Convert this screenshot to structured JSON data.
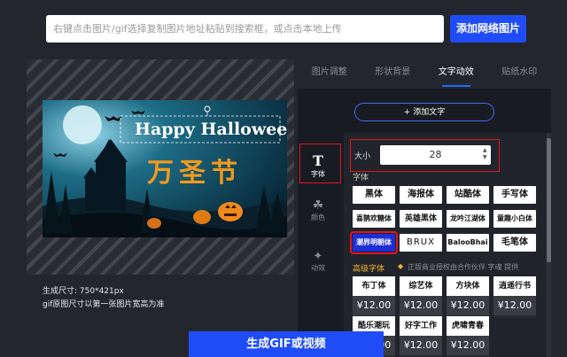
{
  "search": {
    "placeholder": "右键点击图片/gif选择复制图片地址粘贴到搜索框，或点击本地上传"
  },
  "add_image_button": "添加网络图片",
  "banner": {
    "title": "Happy Halloween",
    "subtitle": "万圣节"
  },
  "info": {
    "size_line": "生成尺寸: 750*421px",
    "note_line": "gif原图尺寸以第一张图片宽高为准"
  },
  "tabs": [
    {
      "label": "图片调整"
    },
    {
      "label": "形状背景"
    },
    {
      "label": "文字动效"
    },
    {
      "label": "贴纸水印"
    }
  ],
  "active_tab": "文字动效",
  "add_text_button": "+ 添加文字",
  "side_menu": [
    {
      "label": "字体",
      "icon": "text-T-icon"
    },
    {
      "label": "颜色",
      "icon": "paint-bucket-icon"
    },
    {
      "label": "动效",
      "icon": "sparkle-stars-icon"
    }
  ],
  "size": {
    "label": "大小",
    "value": "28"
  },
  "font_section_label": "字体",
  "fonts": [
    "黑体",
    "海报体",
    "站酷体",
    "手写体",
    "喜鹊欢糖体",
    "英雄黑体",
    "龙吟江湖体",
    "童趣小白体",
    "潮界明朝体",
    "BRUX",
    "BalooBhai",
    "毛笔体"
  ],
  "selected_font": "潮界明朝体",
  "premium": {
    "label": "高级字体",
    "note": "正版商业授权由合作伙伴 字魂 提供",
    "items": [
      {
        "name": "布丁体",
        "price": "¥12.00"
      },
      {
        "name": "综艺体",
        "price": "¥12.00"
      },
      {
        "name": "方块体",
        "price": "¥12.00"
      },
      {
        "name": "逍遥行书",
        "price": "¥12.00"
      },
      {
        "name": "酷乐潮玩",
        "price": "¥12.00"
      },
      {
        "name": "好字工作",
        "price": "¥12.00"
      },
      {
        "name": "虎啸青春",
        "price": "¥12.00"
      }
    ]
  },
  "generate_button": "生成GIF或视频",
  "colors": {
    "accent": "#1f4cf6",
    "highlight": "#e0151f",
    "banner_title": "#ffffff",
    "banner_subtitle": "#f39a1b"
  }
}
